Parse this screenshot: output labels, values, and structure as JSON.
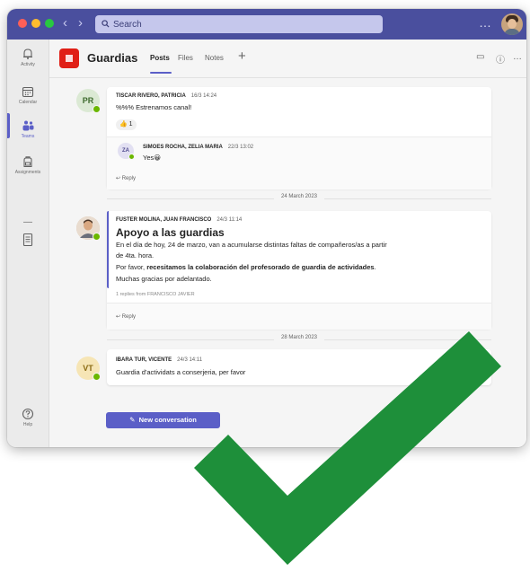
{
  "search": {
    "placeholder": "Search"
  },
  "rail": {
    "items": [
      {
        "label": "Activity",
        "icon": "bell-icon"
      },
      {
        "label": "Calendar",
        "icon": "calendar-icon"
      },
      {
        "label": "Teams",
        "icon": "teams-icon",
        "active": true
      },
      {
        "label": "Assignments",
        "icon": "backpack-icon"
      },
      {
        "label": "",
        "icon": "ellipsis-icon"
      },
      {
        "label": "",
        "icon": "document-icon"
      }
    ],
    "help_label": "Help"
  },
  "team": {
    "name": "Guardias",
    "tabs": [
      "Posts",
      "Files",
      "Notes"
    ],
    "active_tab": "Posts"
  },
  "posts": [
    {
      "initials": "PR",
      "author": "TISCAR RIVERO, PATRICIA",
      "time": "16/3 14:24",
      "text": "%%% Estrenamos canal!",
      "reaction": {
        "emoji": "👍",
        "count": "1"
      },
      "reply": {
        "initials": "ZA",
        "author": "SIMOES ROCHA, ZELIA MARIA",
        "time": "22/3 13:02",
        "text": "Yes😀"
      },
      "reply_label": "Reply"
    },
    {
      "initials": "",
      "author": "FUSTER MOLINA, JUAN FRANCISCO",
      "time": "24/3 11:14",
      "title": "Apoyo a las guardias",
      "lines": [
        "En el día de hoy, 24 de marzo, van a acumularse distintas faltas de compañeros/as a partir",
        "de 4ta. hora.",
        "Por favor, ",
        "recesitamos la colaboración del profesorado de guardia de actividades",
        ".",
        "Muchas gracias por adelantado."
      ],
      "edited": "1 replies from FRANCISCO JAVIER",
      "reply_label": "Reply"
    },
    {
      "initials": "VT",
      "author": "IBARA TUR, VICENTE",
      "time": "24/3 14:11",
      "text": "Guardia d'actividats a conserjeria, per favor"
    }
  ],
  "date_separators": [
    "24 March 2023",
    "28 March 2023"
  ],
  "new_conversation_label": "New conversation",
  "colors": {
    "titlebar": "#4a4f9e",
    "accent": "#5b5fc7",
    "team_logo": "#e01f16",
    "checkmark": "#1e8f3a"
  }
}
